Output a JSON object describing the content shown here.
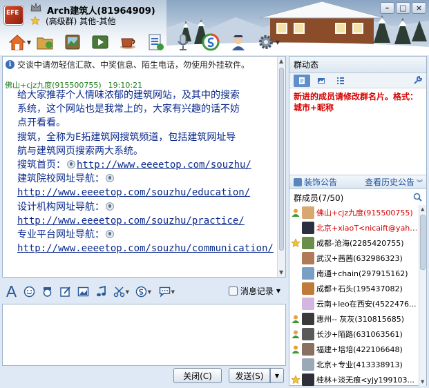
{
  "window": {
    "title": "Arch建筑人(81964909)",
    "subtitle": "(高级群)  其他-其他",
    "controls": [
      "–",
      "□",
      "×"
    ]
  },
  "group_avatar_text": "EFE",
  "notice": {
    "icon": "info-icon",
    "text": "交谈中请勿轻信汇款、中奖信息、陌生电话，勿使用外挂软件。"
  },
  "message": {
    "sender": "佛山+cjz九度(915500755)",
    "time": "19:10:21",
    "lines": [
      "给大家推荐个人情味浓郁的建筑网站，及其中的搜索",
      "系统，这个网站也是我常上的，大家有兴趣的话不妨",
      "点开看看。",
      "搜筑，全称为E拓建筑网搜筑频道，包括建筑网址导",
      "航与建筑网页搜索两大系统。"
    ],
    "home_label": "搜筑首页：",
    "home_link": "http://www.eeeetop.com/souzhu/",
    "edu_label": "建筑院校网址导航：",
    "edu_link": "http://www.eeeetop.com/souzhu/education/",
    "practice_label": "设计机构网址导航：",
    "practice_link": "http://www.eeeetop.com/souzhu/practice/",
    "comm_label": "专业平台网址导航：",
    "comm_link": "http://www.eeeetop.com/souzhu/communication/"
  },
  "input_toolbar": {
    "history_label": "消息记录"
  },
  "buttons": {
    "close": "关闭(C)",
    "send": "发送(S)"
  },
  "right_panel": {
    "header": "群动态",
    "announcement": "新进的成员请修改群名片。格式：城市+昵称",
    "decor_label": "装饰公告",
    "history_label": "查看历史公告",
    "members_label": "群成员(7/50)",
    "members": [
      {
        "name": "佛山+cjz九度(915500755)",
        "red": true,
        "badge": "person",
        "avatar": "#d8a870"
      },
      {
        "name": "北京+xiaoT<nicaift@yaho...",
        "red": true,
        "badge": "none",
        "avatar": "#2a3040"
      },
      {
        "name": "成都-沧海(2285420755)",
        "red": false,
        "badge": "star",
        "avatar": "#6a8f4a"
      },
      {
        "name": "武汉+茜茜(632986323)",
        "red": false,
        "badge": "none",
        "avatar": "#b07a58"
      },
      {
        "name": "南通+chain(297915162)",
        "red": false,
        "badge": "none",
        "avatar": "#7a9ec4"
      },
      {
        "name": "成都+石头(195437082)",
        "red": false,
        "badge": "none",
        "avatar": "#c07a3a"
      },
      {
        "name": "云南+leo在西安(4522476...",
        "red": false,
        "badge": "none",
        "avatar": "#d4b7e0"
      },
      {
        "name": "惠州-- 灰灰(310815685)",
        "red": false,
        "badge": "person",
        "avatar": "#3a3a3a"
      },
      {
        "name": "长沙+陌路(631063561)",
        "red": false,
        "badge": "person",
        "avatar": "#5a5a5a"
      },
      {
        "name": "福建+培培(422106648)",
        "red": false,
        "badge": "person",
        "avatar": "#8a7060"
      },
      {
        "name": "北京+专业(413338913)",
        "red": false,
        "badge": "none",
        "avatar": "#9aa8b8"
      },
      {
        "name": "桂林+淡无痕<yjy199103...",
        "red": false,
        "badge": "star",
        "avatar": "#2f2f3a"
      }
    ]
  },
  "colors": {
    "accent": "#3a6fb8",
    "link": "#0b2a8c",
    "sender": "#1b7a1b",
    "announcement": "#d60000"
  }
}
